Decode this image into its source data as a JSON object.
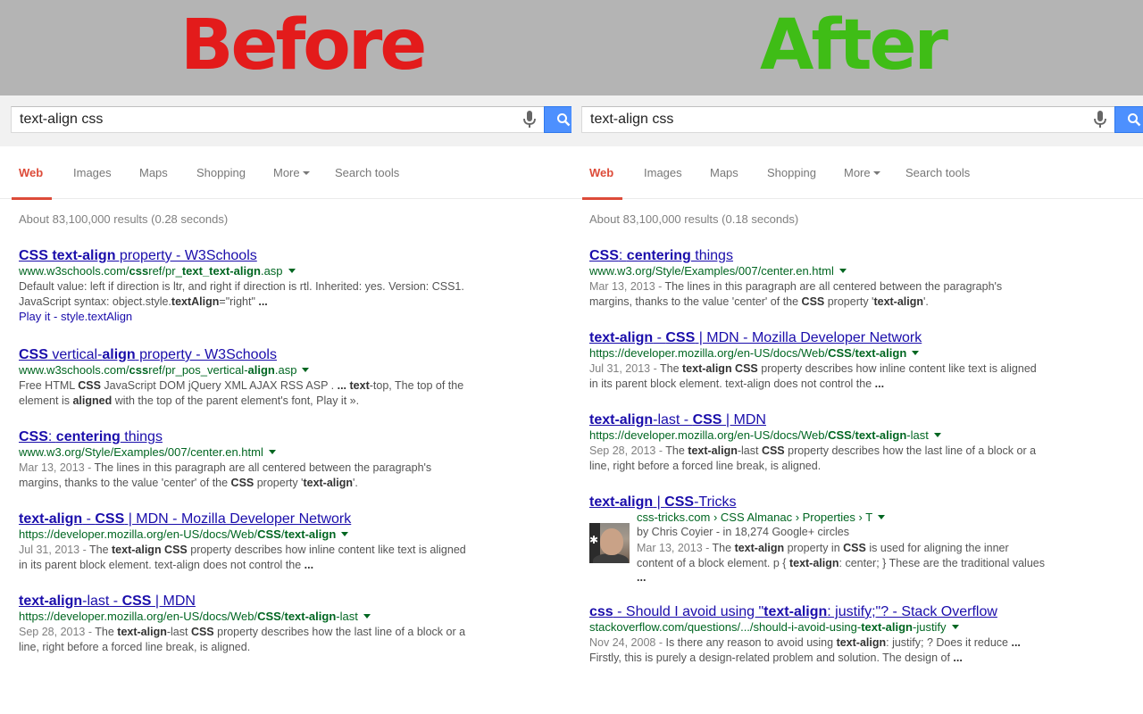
{
  "banner": {
    "before": "Before",
    "after": "After"
  },
  "panes": {
    "left": {
      "query": "text-align css",
      "tabs": [
        "Web",
        "Images",
        "Maps",
        "Shopping",
        "More",
        "Search tools"
      ],
      "stats": "About 83,100,000 results (0.28 seconds)",
      "results": [
        {
          "title_html": "<b>CSS text-align</b> property - W3Schools",
          "url_html": "www.w3schools.com/<b>css</b>ref/pr_<b>text_text-align</b>.asp",
          "snippet_html": "Default value: left if direction is ltr, and right if direction is rtl. Inherited: yes. Version: CSS1. JavaScript syntax: object.style.<b>textAlign</b>=\"right\" <b>...</b>",
          "sitelink": "Play it - style.textAlign"
        },
        {
          "title_html": "<b>CSS</b> vertical-<b>align</b> property - W3Schools",
          "url_html": "www.w3schools.com/<b>css</b>ref/pr_pos_vertical-<b>align</b>.asp",
          "snippet_html": "Free HTML <b>CSS</b> JavaScript DOM jQuery XML AJAX RSS ASP . <b>...</b> <b>text</b>-top, The top of the element is <b>aligned</b> with the top of the parent element's font, Play it »."
        },
        {
          "title_html": "<b>CSS</b>: <b>centering</b> things",
          "url_html": "www.w3.org/Style/Examples/007/center.en.html",
          "snippet_html": "<span class=\"date\">Mar 13, 2013 - </span>The lines in this paragraph are all centered between the paragraph's margins, thanks to the value 'center' of the <b>CSS</b> property '<b>text-align</b>'."
        },
        {
          "title_html": "<b>text-align</b> - <b>CSS</b> | MDN - Mozilla Developer Network",
          "url_html": "https://developer.mozilla.org/en-US/docs/Web/<b>CSS</b>/<b>text-align</b>",
          "snippet_html": "<span class=\"date\">Jul 31, 2013 - </span>The <b>text-align CSS</b> property describes how inline content like text is aligned in its parent block element. text-align does not control the <b>...</b>"
        },
        {
          "title_html": "<b>text-align</b>-last - <b>CSS</b> | MDN",
          "url_html": "https://developer.mozilla.org/en-US/docs/Web/<b>CSS</b>/<b>text-align</b>-last",
          "snippet_html": "<span class=\"date\">Sep 28, 2013 - </span>The <b>text-align</b>-last <b>CSS</b> property describes how the last line of a block or a line, right before a forced line break, is aligned."
        }
      ]
    },
    "right": {
      "query": "text-align css",
      "tabs": [
        "Web",
        "Images",
        "Maps",
        "Shopping",
        "More",
        "Search tools"
      ],
      "stats": "About 83,100,000 results (0.18 seconds)",
      "results": [
        {
          "title_html": "<b>CSS</b>: <b>centering</b> things",
          "url_html": "www.w3.org/Style/Examples/007/center.en.html",
          "snippet_html": "<span class=\"date\">Mar 13, 2013 - </span>The lines in this paragraph are all centered between the paragraph's margins, thanks to the value 'center' of the <b>CSS</b> property '<b>text-align</b>'."
        },
        {
          "title_html": "<b>text-align</b> - <b>CSS</b> | MDN - Mozilla Developer Network",
          "url_html": "https://developer.mozilla.org/en-US/docs/Web/<b>CSS</b>/<b>text-align</b>",
          "snippet_html": "<span class=\"date\">Jul 31, 2013 - </span>The <b>text-align CSS</b> property describes how inline content like text is aligned in its parent block element. text-align does not control the <b>...</b>"
        },
        {
          "title_html": "<b>text-align</b>-last - <b>CSS</b> | MDN",
          "url_html": "https://developer.mozilla.org/en-US/docs/Web/<b>CSS</b>/<b>text-align</b>-last",
          "snippet_html": "<span class=\"date\">Sep 28, 2013 - </span>The <b>text-align</b>-last <b>CSS</b> property describes how the last line of a block or a line, right before a forced line break, is aligned."
        },
        {
          "title_html": "<b>text-align</b> | <b>CSS</b>-Tricks",
          "url_html": "css-tricks.com › CSS Almanac › Properties › T",
          "author": "by Chris Coyier - in 18,274 Google+ circles",
          "snippet_html": "<span class=\"date\">Mar 13, 2013 - </span>The <b>text-align</b> property in <b>CSS</b> is used for aligning the inner content of a block element. p { <b>text-align</b>: center; } These are the traditional values <b>...</b>"
        },
        {
          "title_html": "<b>css</b> - Should I avoid using \"<b>text-align</b>: justify;\"? - Stack Overflow",
          "url_html": "stackoverflow.com/questions/.../should-i-avoid-using-<b>text-align</b>-justify",
          "snippet_html": "<span class=\"date\">Nov 24, 2008 - </span>Is there any reason to avoid using <b>text-align</b>: justify; ? Does it reduce <b>...</b> Firstly, this is purely a design-related problem and solution. The design of <b>...</b>"
        }
      ]
    }
  }
}
